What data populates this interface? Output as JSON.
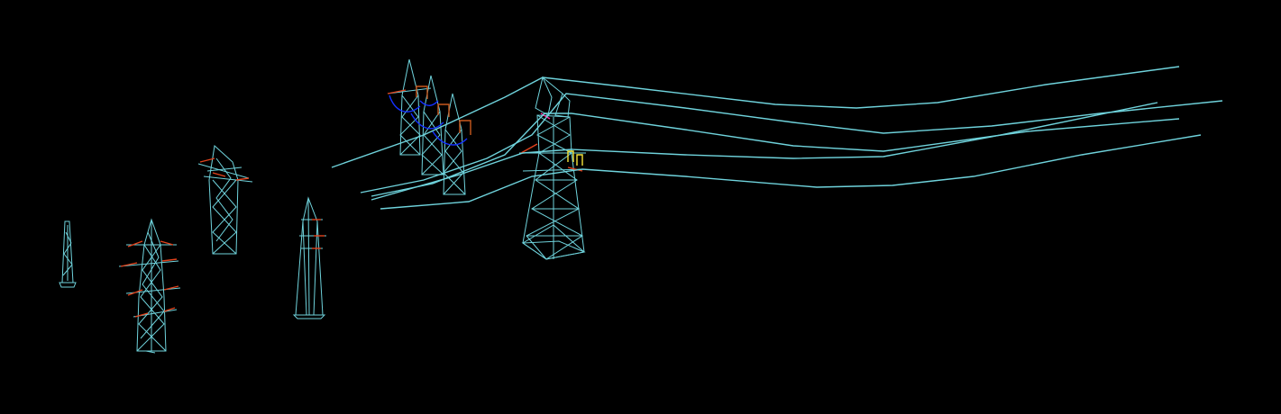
{
  "scene": {
    "background": "#000000",
    "colors": {
      "steel": "#6fd3dc",
      "insulator": "#e2421c",
      "jumper": "#1431ff",
      "bracket": "#c8581c",
      "marker": "#f5e33a",
      "pink": "#ff2aa0",
      "mast_top": "#f0a020"
    },
    "objects": [
      {
        "id": "tower-1",
        "kind": "monopole",
        "icon": "monopole-mast-icon"
      },
      {
        "id": "tower-2",
        "kind": "double-circuit lattice tower",
        "icon": "lattice-tower-icon"
      },
      {
        "id": "tower-3",
        "kind": "lattice tower",
        "icon": "lattice-tower-icon"
      },
      {
        "id": "tower-4",
        "kind": "tapered pylon",
        "icon": "pylon-icon"
      },
      {
        "id": "tower-5",
        "kind": "tension lattice towers group",
        "icon": "lattice-tower-icon"
      },
      {
        "id": "tower-6",
        "kind": "large lattice tower with conductors",
        "icon": "lattice-tower-icon"
      }
    ],
    "conductor_count": 7
  }
}
